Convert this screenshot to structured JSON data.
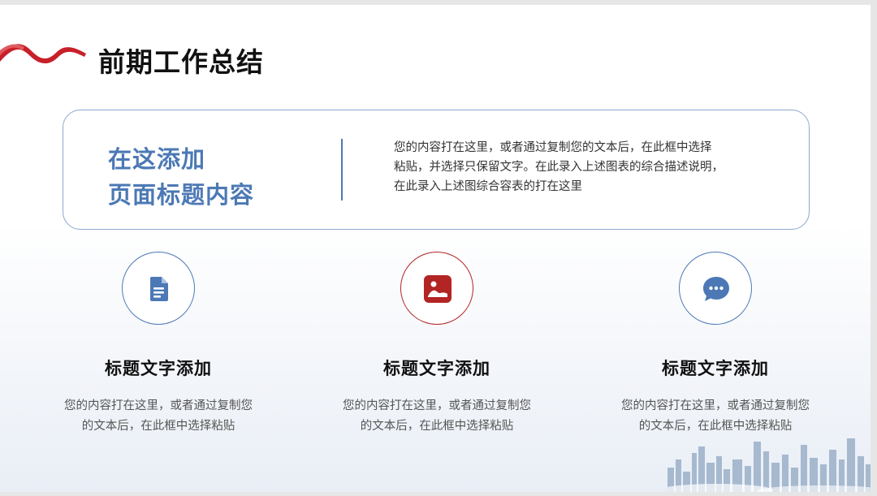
{
  "slide": {
    "title": "前期工作总结",
    "colors": {
      "accent": "#4c79b5",
      "brand_red": "#b32424",
      "title": "#111111"
    },
    "decorations": [
      "red-ribbon",
      "city-skyline"
    ]
  },
  "card": {
    "heading_line1": "在这添加",
    "heading_line2": "页面标题内容",
    "body_line1": "您的内容打在这里，或者通过复制您的文本后，在此框中选择",
    "body_line2": "粘贴，并选择只保留文字。在此录入上述图表的综合描述说明，",
    "body_line3": "在此录入上述图综合容表的打在这里"
  },
  "features": [
    {
      "icon": "document-icon",
      "title": "标题文字添加",
      "desc_line1": "您的内容打在这里，或者通过复制您",
      "desc_line2": "的文本后，在此框中选择粘贴"
    },
    {
      "icon": "image-icon",
      "title": "标题文字添加",
      "desc_line1": "您的内容打在这里，或者通过复制您",
      "desc_line2": "的文本后，在此框中选择粘贴"
    },
    {
      "icon": "chat-bubble-icon",
      "title": "标题文字添加",
      "desc_line1": "您的内容打在这里，或者通过复制您",
      "desc_line2": "的文本后，在此框中选择粘贴"
    }
  ]
}
